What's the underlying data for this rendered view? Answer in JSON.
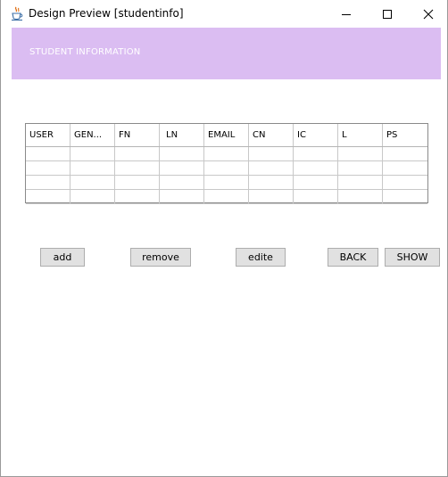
{
  "window": {
    "title": "Design Preview [studentinfo]",
    "icon": "java-cup-icon",
    "controls": {
      "minimize": "minimize-icon",
      "maximize": "maximize-icon",
      "close": "close-icon"
    }
  },
  "header": {
    "label": "STUDENT INFORMATION",
    "background": "#dbbdf2",
    "text_color": "#ffffff"
  },
  "table": {
    "columns": [
      "USER",
      "GEN...",
      "FN",
      "LN",
      "EMAIL",
      "CN",
      "IC",
      "L",
      "PS"
    ],
    "rows": [
      [
        "",
        "",
        "",
        "",
        "",
        "",
        "",
        "",
        ""
      ],
      [
        "",
        "",
        "",
        "",
        "",
        "",
        "",
        "",
        ""
      ],
      [
        "",
        "",
        "",
        "",
        "",
        "",
        "",
        "",
        ""
      ],
      [
        "",
        "",
        "",
        "",
        "",
        "",
        "",
        "",
        ""
      ]
    ]
  },
  "buttons": {
    "add": "add",
    "remove": "remove",
    "edite": "edite",
    "back": "BACK",
    "show": "SHOW"
  }
}
